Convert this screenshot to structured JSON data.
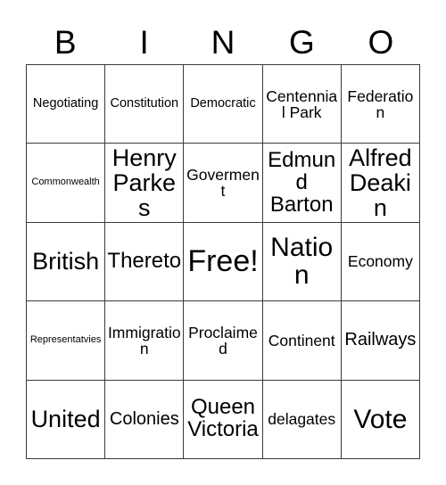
{
  "card": {
    "header_letters": [
      "B",
      "I",
      "N",
      "G",
      "O"
    ],
    "border_color": "#3a3a3a",
    "background_color": "#ffffff",
    "text_color": "#000000",
    "rows": [
      [
        {
          "label": "Negotiating",
          "size": "sm"
        },
        {
          "label": "Constitution",
          "size": "sm"
        },
        {
          "label": "Democratic",
          "size": "sm"
        },
        {
          "label": "Centennial Park",
          "size": "md"
        },
        {
          "label": "Federation",
          "size": "md"
        }
      ],
      [
        {
          "label": "Commonwealth",
          "size": "xs"
        },
        {
          "label": "Henry Parkes",
          "size": "2xl"
        },
        {
          "label": "Goverment",
          "size": "md"
        },
        {
          "label": "Edmund Barton",
          "size": "xl"
        },
        {
          "label": "Alfred Deakin",
          "size": "2xl"
        }
      ],
      [
        {
          "label": "British",
          "size": "2xl"
        },
        {
          "label": "Thereto",
          "size": "xl"
        },
        {
          "label": "Free!",
          "size": "4xl"
        },
        {
          "label": "Nation",
          "size": "3xl"
        },
        {
          "label": "Economy",
          "size": "md"
        }
      ],
      [
        {
          "label": "Representatvies",
          "size": "xs"
        },
        {
          "label": "Immigration",
          "size": "md"
        },
        {
          "label": "Proclaimed",
          "size": "md"
        },
        {
          "label": "Continent",
          "size": "md"
        },
        {
          "label": "Railways",
          "size": "lg"
        }
      ],
      [
        {
          "label": "United",
          "size": "2xl"
        },
        {
          "label": "Colonies",
          "size": "lg"
        },
        {
          "label": "Queen Victoria",
          "size": "xl"
        },
        {
          "label": "delagates",
          "size": "md"
        },
        {
          "label": "Vote",
          "size": "3xl"
        }
      ]
    ]
  }
}
